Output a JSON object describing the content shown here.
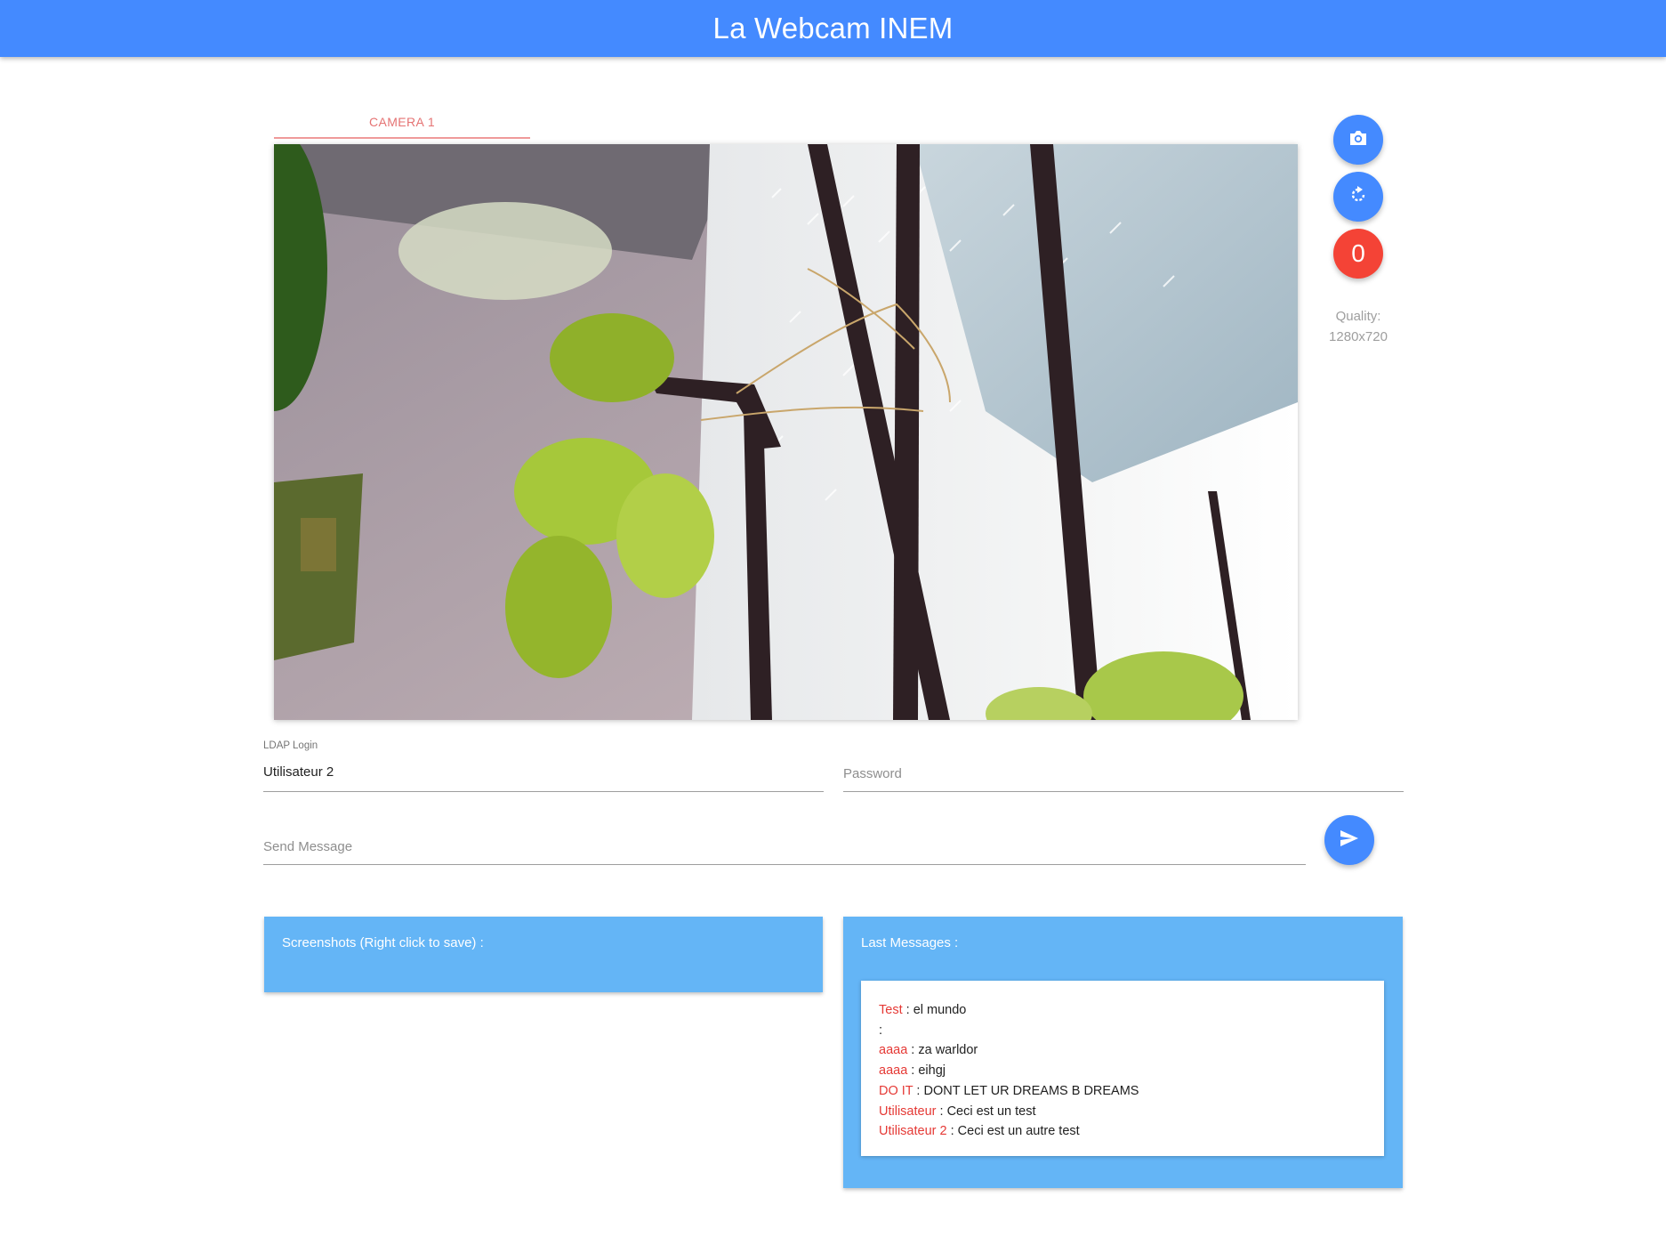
{
  "app": {
    "title": "La Webcam INEM"
  },
  "tabs": [
    {
      "label": "CAMERA 1",
      "active": true
    }
  ],
  "controls": {
    "screenshot_icon": "camera-icon",
    "reload_icon": "refresh-icon",
    "counter_value": "0",
    "quality_label": "Quality:",
    "quality_value": "1280x720"
  },
  "login": {
    "ldap_label": "LDAP Login",
    "ldap_value": "Utilisateur 2",
    "password_placeholder": "Password"
  },
  "message": {
    "placeholder": "Send Message",
    "send_icon": "send-icon"
  },
  "screenshots_panel": {
    "title": "Screenshots (Right click to save) :"
  },
  "messages_panel": {
    "title": "Last Messages :",
    "items": [
      {
        "user": "Test",
        "sep": " : ",
        "text": "el mundo"
      },
      {
        "user": "",
        "sep": ":",
        "text": ""
      },
      {
        "user": "aaaa",
        "sep": " : ",
        "text": "za warldor"
      },
      {
        "user": "aaaa",
        "sep": " : ",
        "text": "eihgj"
      },
      {
        "user": "DO IT",
        "sep": " : ",
        "text": "DONT LET UR DREAMS B DREAMS"
      },
      {
        "user": "Utilisateur",
        "sep": " : ",
        "text": "Ceci est un test"
      },
      {
        "user": "Utilisateur 2",
        "sep": " : ",
        "text": "Ceci est un autre test"
      }
    ]
  },
  "colors": {
    "primary": "#448aff",
    "accent": "#f44336",
    "card": "#64b5f6",
    "username": "#e53935",
    "tab": "#e57373"
  }
}
